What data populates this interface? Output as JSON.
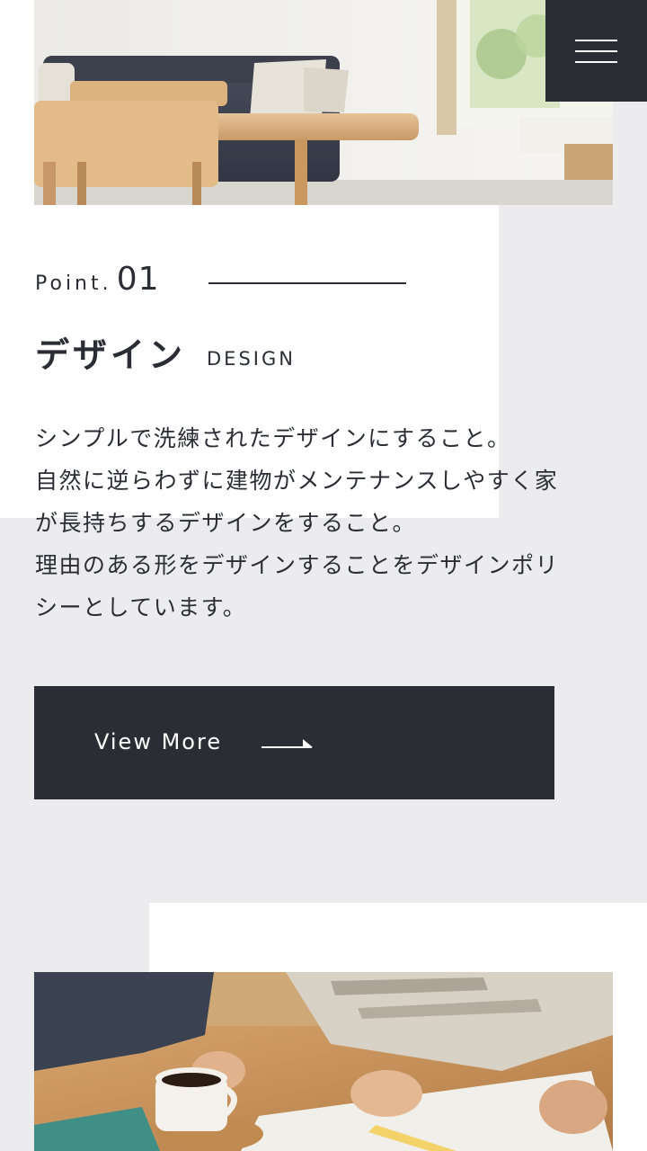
{
  "menu": {
    "icon": "hamburger-menu-icon",
    "background": "#2a2d33"
  },
  "point": {
    "label": "Point.",
    "number": "01"
  },
  "section": {
    "title_jp": "デザイン",
    "title_en": "DESIGN",
    "body_lines": [
      "シンプルで洗練されたデザインにすること。",
      "自然に逆らわずに建物がメンテナンスしやすく家",
      "が長持ちするデザインをすること。",
      "理由のある形をデザインすることをデザインポリ",
      "シーとしています。"
    ]
  },
  "cta": {
    "label": "View More",
    "icon": "arrow-right-icon"
  },
  "colors": {
    "dark": "#2a2d33",
    "page_background": "#ececee",
    "panel": "#ffffff"
  }
}
